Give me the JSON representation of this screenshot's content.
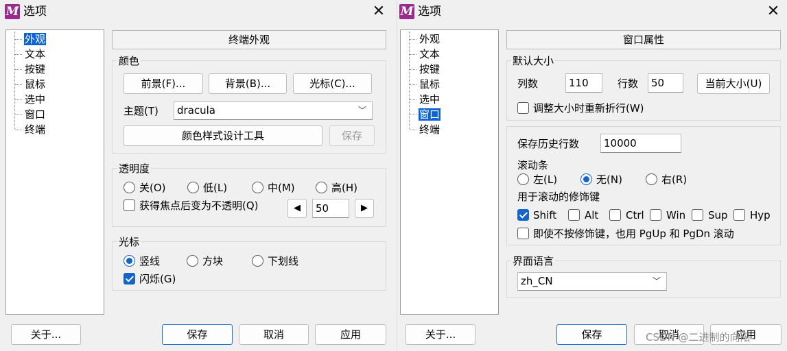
{
  "left_dialog": {
    "title": "选项",
    "tree": [
      "外观",
      "文本",
      "按键",
      "鼠标",
      "选中",
      "窗口",
      "终端"
    ],
    "panel_header": "终端外观",
    "color_group": {
      "label": "颜色",
      "foreground_button": "前景(F)...",
      "background_button": "背景(B)...",
      "cursor_button": "光标(C)...",
      "theme_label": "主题(T)",
      "theme_value": "dracula",
      "style_tool_button": "颜色样式设计工具",
      "save_button": "保存"
    },
    "transparency_group": {
      "label": "透明度",
      "options": [
        "关(O)",
        "低(L)",
        "中(M)",
        "高(H)"
      ],
      "opaque_on_focus": "获得焦点后变为不透明(Q)",
      "value": "50",
      "left_arrow": "◀",
      "right_arrow": "▶"
    },
    "cursor_group": {
      "label": "光标",
      "options": [
        "竖线",
        "方块",
        "下划线"
      ],
      "blink": "闪烁(G)"
    },
    "about_button": "关于...",
    "save_button": "保存",
    "cancel_button": "取消",
    "apply_button": "应用"
  },
  "right_dialog": {
    "title": "选项",
    "tree": [
      "外观",
      "文本",
      "按键",
      "鼠标",
      "选中",
      "窗口",
      "终端"
    ],
    "panel_header": "窗口属性",
    "default_size": {
      "label": "默认大小",
      "columns_label": "列数",
      "columns_value": "110",
      "rows_label": "行数",
      "rows_value": "50",
      "current_size_button": "当前大小(U)",
      "reflow_label": "调整大小时重新折行(W)"
    },
    "history": {
      "label": "保存历史行数",
      "value": "10000",
      "scrollbar_label": "滚动条",
      "scrollbar_options": [
        "左(L)",
        "无(N)",
        "右(R)"
      ],
      "modifier_label": "用于滚动的修饰键",
      "modifiers": [
        "Shift",
        "Alt",
        "Ctrl",
        "Win",
        "Sup",
        "Hyp"
      ],
      "pgup_label": "即使不按修饰键，也用 PgUp 和 PgDn 滚动"
    },
    "language": {
      "label": "界面语言",
      "value": "zh_CN"
    },
    "about_button": "关于...",
    "save_button": "保存",
    "cancel_button": "取消",
    "apply_button": "应用"
  },
  "watermark": "CSDN @二进制的向阳",
  "colors": {
    "accent": "#1565c8",
    "selection": "#0a64d8",
    "logo": "#9b2a8f"
  }
}
